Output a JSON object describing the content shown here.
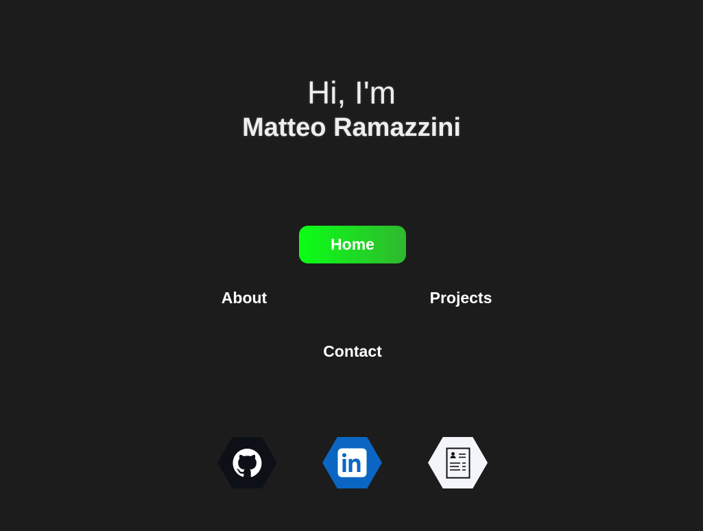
{
  "hero": {
    "greeting": "Hi, I'm",
    "name": "Matteo Ramazzini"
  },
  "nav": {
    "home": "Home",
    "about": "About",
    "projects": "Projects",
    "contact": "Contact",
    "active": "home"
  },
  "social": [
    {
      "icon": "github-icon",
      "color": "#0d1117"
    },
    {
      "icon": "linkedin-icon",
      "color": "#0a66c2"
    },
    {
      "icon": "resume-icon",
      "color": "#f4f5fa"
    }
  ],
  "colors": {
    "background": "#1c1c1c",
    "accent_start": "#0bff16",
    "accent_end": "#2fb82f",
    "text": "#ffffff"
  }
}
